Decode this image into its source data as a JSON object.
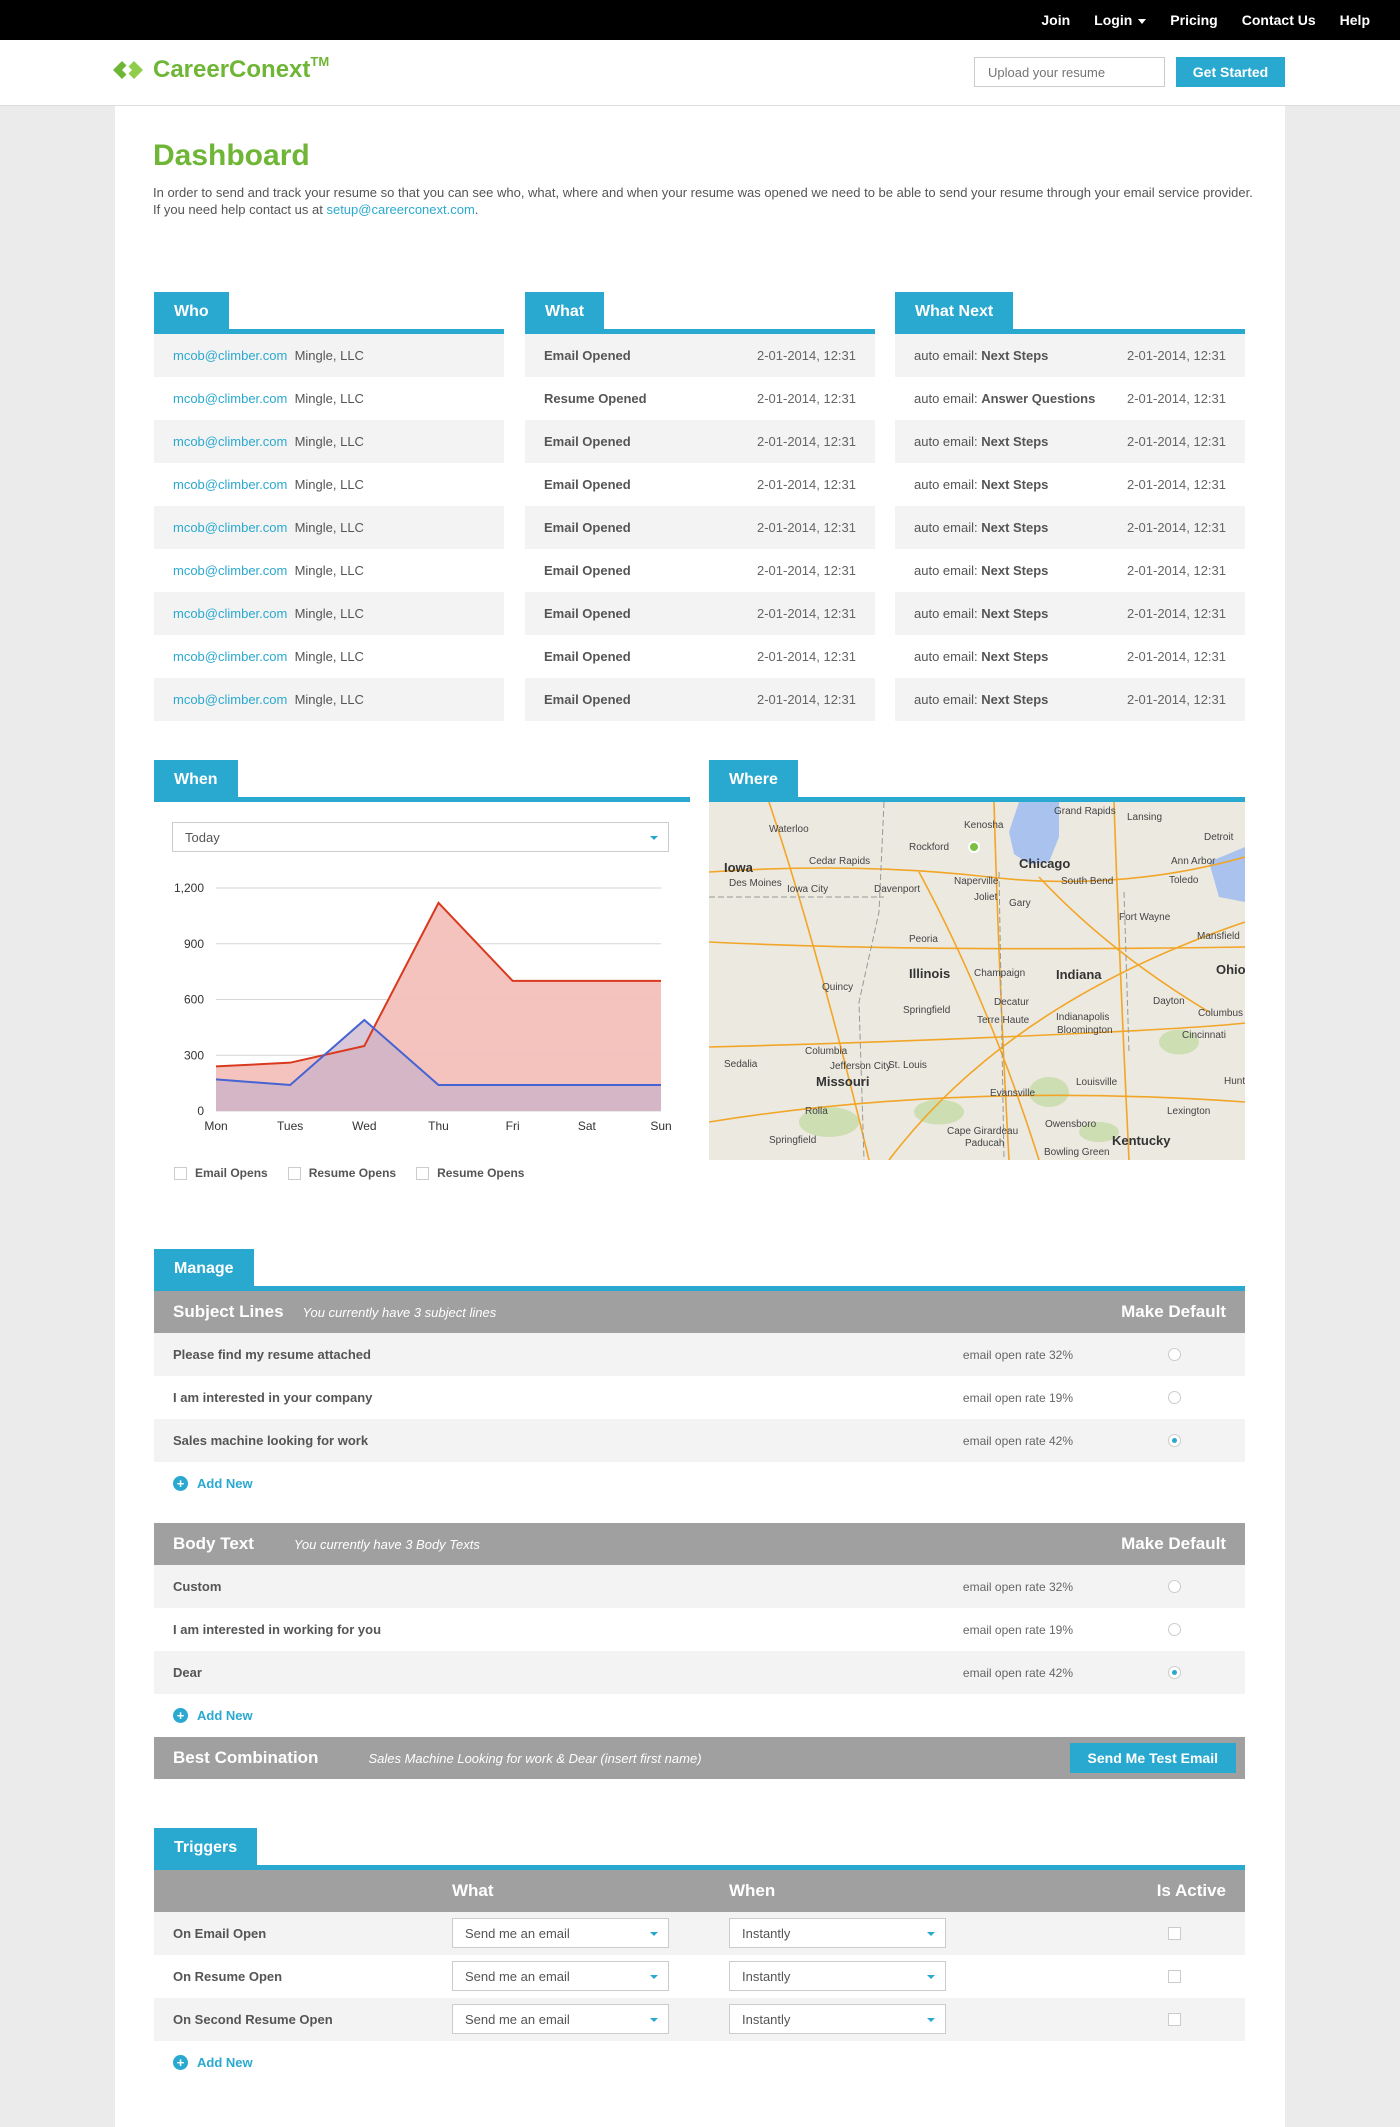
{
  "topnav": {
    "join": "Join",
    "login": "Login",
    "pricing": "Pricing",
    "contact": "Contact Us",
    "help": "Help"
  },
  "header": {
    "logo": "CareerConext",
    "tm": "TM",
    "upload_placeholder": "Upload your resume",
    "get_started": "Get Started"
  },
  "dashboard": {
    "title": "Dashboard",
    "intro_1": "In order to send and track your resume so that you can see who, what, where and when your resume was opened we need to be able to send your resume through your email service provider.",
    "intro_2": "If you need help contact us at",
    "email": "setup@careerconext.com",
    "period": "."
  },
  "who": {
    "title": "Who",
    "rows": [
      {
        "email": "mcob@climber.com",
        "company": "Mingle, LLC"
      },
      {
        "email": "mcob@climber.com",
        "company": "Mingle, LLC"
      },
      {
        "email": "mcob@climber.com",
        "company": "Mingle, LLC"
      },
      {
        "email": "mcob@climber.com",
        "company": "Mingle, LLC"
      },
      {
        "email": "mcob@climber.com",
        "company": "Mingle, LLC"
      },
      {
        "email": "mcob@climber.com",
        "company": "Mingle, LLC"
      },
      {
        "email": "mcob@climber.com",
        "company": "Mingle, LLC"
      },
      {
        "email": "mcob@climber.com",
        "company": "Mingle, LLC"
      },
      {
        "email": "mcob@climber.com",
        "company": "Mingle, LLC"
      }
    ]
  },
  "what": {
    "title": "What",
    "rows": [
      {
        "event": "Email Opened",
        "time": "2-01-2014, 12:31"
      },
      {
        "event": "Resume Opened",
        "time": "2-01-2014, 12:31"
      },
      {
        "event": "Email Opened",
        "time": "2-01-2014, 12:31"
      },
      {
        "event": "Email Opened",
        "time": "2-01-2014, 12:31"
      },
      {
        "event": "Email Opened",
        "time": "2-01-2014, 12:31"
      },
      {
        "event": "Email Opened",
        "time": "2-01-2014, 12:31"
      },
      {
        "event": "Email Opened",
        "time": "2-01-2014, 12:31"
      },
      {
        "event": "Email Opened",
        "time": "2-01-2014, 12:31"
      },
      {
        "event": "Email Opened",
        "time": "2-01-2014, 12:31"
      }
    ]
  },
  "whatnext": {
    "title": "What Next",
    "prefix": "auto email:",
    "rows": [
      {
        "action": "Next Steps",
        "time": "2-01-2014, 12:31"
      },
      {
        "action": "Answer Questions",
        "time": "2-01-2014, 12:31"
      },
      {
        "action": "Next Steps",
        "time": "2-01-2014, 12:31"
      },
      {
        "action": "Next Steps",
        "time": "2-01-2014, 12:31"
      },
      {
        "action": "Next Steps",
        "time": "2-01-2014, 12:31"
      },
      {
        "action": "Next Steps",
        "time": "2-01-2014, 12:31"
      },
      {
        "action": "Next Steps",
        "time": "2-01-2014, 12:31"
      },
      {
        "action": "Next Steps",
        "time": "2-01-2014, 12:31"
      },
      {
        "action": "Next Steps",
        "time": "2-01-2014, 12:31"
      }
    ]
  },
  "when": {
    "title": "When",
    "range": "Today",
    "legend": [
      "Email Opens",
      "Resume Opens",
      "Resume Opens"
    ]
  },
  "chart_data": {
    "type": "area",
    "categories": [
      "Mon",
      "Tues",
      "Wed",
      "Thu",
      "Fri",
      "Sat",
      "Sun"
    ],
    "series": [
      {
        "values": [
          240,
          260,
          350,
          1120,
          700,
          700,
          700
        ],
        "color": "#d9391e",
        "fill": "#f3c0bb"
      },
      {
        "values": [
          170,
          140,
          490,
          140,
          140,
          140,
          140
        ],
        "color": "#4563d3",
        "fill": "#c7b0c9"
      }
    ],
    "yticks": [
      "1,200",
      "900",
      "600",
      "300",
      "0"
    ],
    "ylim": [
      0,
      1200
    ],
    "grid": true
  },
  "where": {
    "title": "Where",
    "labels": [
      "Grand Rapids",
      "Lansing",
      "Detroit",
      "Waterloo",
      "Kenosha",
      "Rockford",
      "Cedar Rapids",
      "Chicago",
      "Ann Arbor",
      "Iowa",
      "Des Moines",
      "Iowa City",
      "Davenport",
      "Naperville",
      "Joliet",
      "Gary",
      "South Bend",
      "Toledo",
      "Fort Wayne",
      "Mansfield",
      "Peoria",
      "Illinois",
      "Champaign",
      "Indiana",
      "Ohio",
      "Quincy",
      "Decatur",
      "Dayton",
      "Springfield",
      "Columbus",
      "Terre Haute",
      "Indianapolis",
      "Bloomington",
      "Cincinnati",
      "Columbia",
      "Jefferson City",
      "St. Louis",
      "Louisville",
      "Missouri",
      "Evansville",
      "Lexington",
      "Rolla",
      "Owensboro",
      "Cape Girardeau",
      "Paducah",
      "Kentucky",
      "Springfield",
      "Bowling Green",
      "Huntington",
      "Sedalia"
    ]
  },
  "manage": {
    "title": "Manage",
    "subject": {
      "title": "Subject Lines",
      "note": "You currently have 3 subject lines",
      "default_label": "Make Default",
      "rows": [
        {
          "name": "Please find my resume attached",
          "rate": "email open rate 32%",
          "default": false
        },
        {
          "name": "I am interested in your company",
          "rate": "email open rate 19%",
          "default": false
        },
        {
          "name": "Sales machine looking for work",
          "rate": "email open rate 42%",
          "default": true
        }
      ]
    },
    "add_new": "Add New",
    "body": {
      "title": "Body Text",
      "note": "You currently have 3 Body Texts",
      "default_label": "Make Default",
      "rows": [
        {
          "name": "Custom",
          "rate": "email open rate 32%",
          "default": false
        },
        {
          "name": "I am interested in working for you",
          "rate": "email open rate 19%",
          "default": false
        },
        {
          "name": "Dear",
          "rate": "email open rate 42%",
          "default": true
        }
      ]
    },
    "best": {
      "title": "Best Combination",
      "note": "Sales Machine Looking for work & Dear (insert first name)",
      "button": "Send Me Test Email"
    }
  },
  "triggers": {
    "title": "Triggers",
    "headers": {
      "what": "What",
      "when": "When",
      "active": "Is Active"
    },
    "rows": [
      {
        "name": "On Email Open",
        "what": "Send me an email",
        "when": "Instantly"
      },
      {
        "name": "On Resume Open",
        "what": "Send me an email",
        "when": "Instantly"
      },
      {
        "name": "On Second Resume Open",
        "what": "Send me an email",
        "when": "Instantly"
      }
    ],
    "add_new": "Add New"
  },
  "colors": {
    "accent": "#2aa9d0",
    "brand": "#6fb636",
    "header_grey": "#a0a0a0"
  }
}
